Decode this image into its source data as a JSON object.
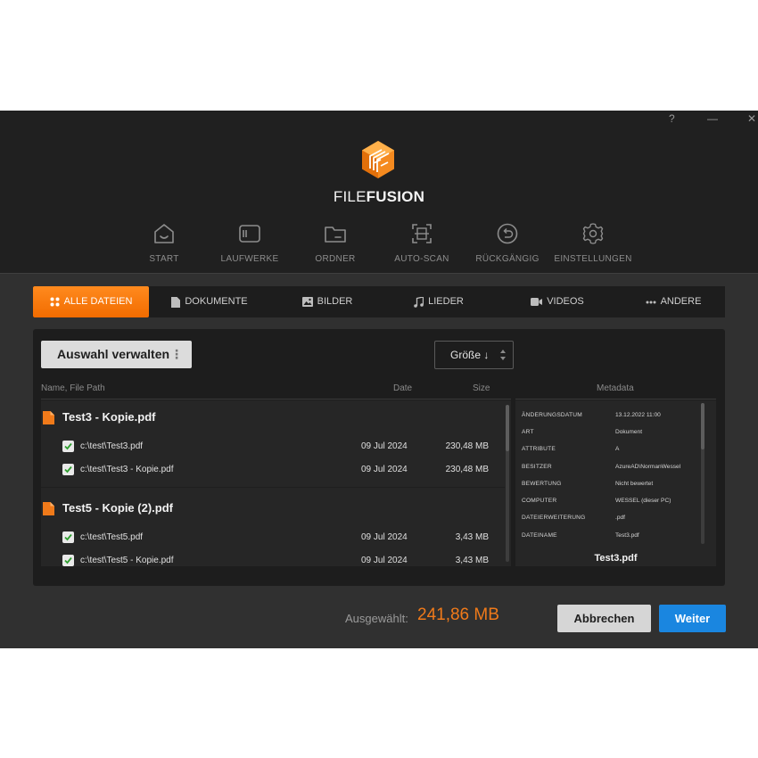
{
  "window": {
    "help": "?",
    "minimize": "—",
    "close": "✕"
  },
  "brand": {
    "part1": "FILE",
    "part2": "FUSION"
  },
  "nav": [
    {
      "label": "START",
      "icon": "home-icon"
    },
    {
      "label": "LAUFWERKE",
      "icon": "drive-icon"
    },
    {
      "label": "ORDNER",
      "icon": "folder-icon"
    },
    {
      "label": "AUTO-SCAN",
      "icon": "scan-icon"
    },
    {
      "label": "RÜCKGÄNGIG",
      "icon": "undo-icon"
    },
    {
      "label": "EINSTELLUNGEN",
      "icon": "gear-icon"
    }
  ],
  "tabs": [
    {
      "label": "ALLE DATEIEN",
      "icon": "grid-icon",
      "active": true
    },
    {
      "label": "DOKUMENTE",
      "icon": "document-icon"
    },
    {
      "label": "BILDER",
      "icon": "image-icon"
    },
    {
      "label": "LIEDER",
      "icon": "music-icon"
    },
    {
      "label": "VIDEOS",
      "icon": "video-icon"
    },
    {
      "label": "ANDERE",
      "icon": "more-icon"
    }
  ],
  "toolbar": {
    "manage_label": "Auswahl verwalten",
    "sort_label": "Größe ↓"
  },
  "columns": {
    "name": "Name, File Path",
    "date": "Date",
    "size": "Size",
    "metadata": "Metadata"
  },
  "groups": [
    {
      "title": "Test3 - Kopie.pdf",
      "files": [
        {
          "path": "c:\\test\\Test3.pdf",
          "date": "09 Jul 2024",
          "size": "230,48 MB",
          "checked": true
        },
        {
          "path": "c:\\test\\Test3 - Kopie.pdf",
          "date": "09 Jul 2024",
          "size": "230,48 MB",
          "checked": true
        }
      ]
    },
    {
      "title": "Test5 - Kopie (2).pdf",
      "files": [
        {
          "path": "c:\\test\\Test5.pdf",
          "date": "09 Jul 2024",
          "size": "3,43 MB",
          "checked": true
        },
        {
          "path": "c:\\test\\Test5 - Kopie.pdf",
          "date": "09 Jul 2024",
          "size": "3,43 MB",
          "checked": true
        }
      ]
    }
  ],
  "metadata": {
    "rows": [
      {
        "key": "ÄNDERUNGSDATUM",
        "value": "13.12.2022 11:00"
      },
      {
        "key": "ART",
        "value": "Dokument"
      },
      {
        "key": "ATTRIBUTE",
        "value": "A"
      },
      {
        "key": "BESITZER",
        "value": "AzureAD\\NormanWessel"
      },
      {
        "key": "BEWERTUNG",
        "value": "Nicht bewertet"
      },
      {
        "key": "COMPUTER",
        "value": "WESSEL (dieser PC)"
      },
      {
        "key": "DATEIERWEITERUNG",
        "value": ".pdf"
      },
      {
        "key": "DATEINAME",
        "value": "Test3.pdf"
      }
    ],
    "filename": "Test3.pdf"
  },
  "footer": {
    "selected_label": "Ausgewählt:",
    "selected_value": "241,86 MB",
    "cancel_label": "Abbrechen",
    "next_label": "Weiter"
  },
  "colors": {
    "accent": "#f26c00",
    "primary": "#1a86e0",
    "background": "#303030",
    "panel": "#1d1d1d"
  }
}
